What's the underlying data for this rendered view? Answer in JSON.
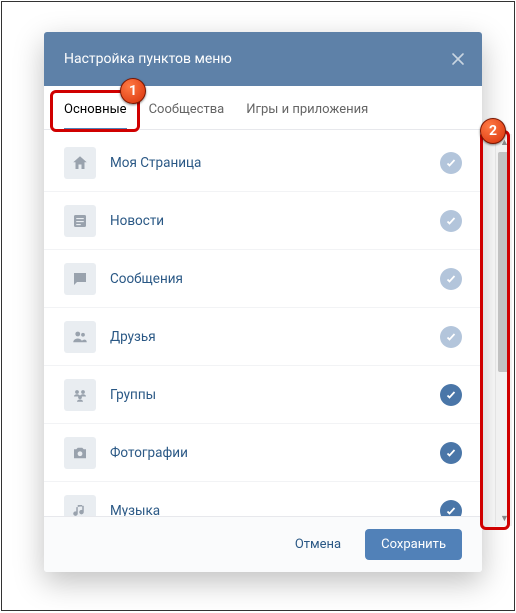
{
  "header": {
    "title": "Настройка пунктов меню"
  },
  "tabs": [
    {
      "label": "Основные",
      "active": true
    },
    {
      "label": "Сообщества",
      "active": false
    },
    {
      "label": "Игры и приложения",
      "active": false
    }
  ],
  "items": [
    {
      "icon": "home",
      "label": "Моя Страница",
      "locked": true,
      "checked": true
    },
    {
      "icon": "news",
      "label": "Новости",
      "locked": true,
      "checked": true
    },
    {
      "icon": "message",
      "label": "Сообщения",
      "locked": true,
      "checked": true
    },
    {
      "icon": "friends",
      "label": "Друзья",
      "locked": true,
      "checked": true
    },
    {
      "icon": "groups",
      "label": "Группы",
      "locked": false,
      "checked": true
    },
    {
      "icon": "photos",
      "label": "Фотографии",
      "locked": false,
      "checked": true
    },
    {
      "icon": "music",
      "label": "Музыка",
      "locked": false,
      "checked": true
    }
  ],
  "footer": {
    "cancel": "Отмена",
    "save": "Сохранить"
  },
  "annotations": {
    "badge1": "1",
    "badge2": "2"
  }
}
